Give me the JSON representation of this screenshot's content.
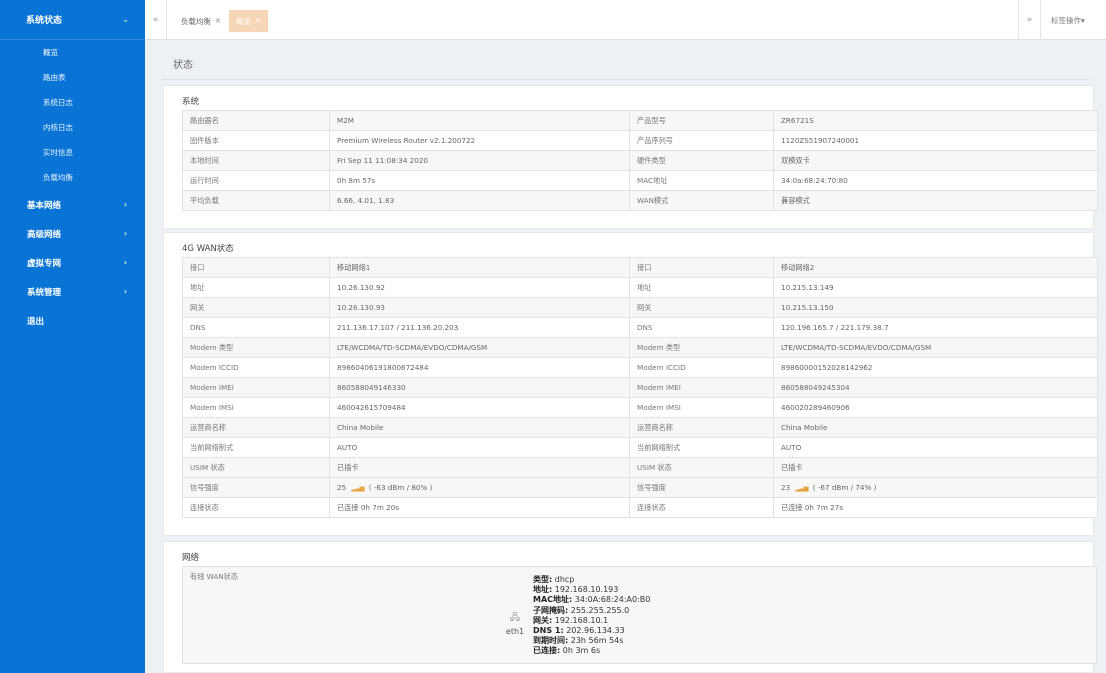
{
  "sidebar": {
    "top": {
      "label": "系统状态"
    },
    "sub_items": [
      {
        "label": "概览"
      },
      {
        "label": "路由表"
      },
      {
        "label": "系统日志"
      },
      {
        "label": "内核日志"
      },
      {
        "label": "实时信息"
      },
      {
        "label": "负载均衡"
      }
    ],
    "menus": [
      {
        "label": "基本网络"
      },
      {
        "label": "高级网络"
      },
      {
        "label": "虚拟专网"
      },
      {
        "label": "系统管理"
      }
    ],
    "logout": "退出"
  },
  "tabbar": {
    "tabs": [
      {
        "label": "负载均衡"
      },
      {
        "label": "概览"
      }
    ],
    "ops_label": "标签操作"
  },
  "page": {
    "title": "状态"
  },
  "system": {
    "title": "系统",
    "rows": [
      {
        "k1": "路由器名",
        "v1": "M2M",
        "k2": "产品型号",
        "v2": "ZR6721S"
      },
      {
        "k1": "固件版本",
        "v1": "Premium Wireless Router v2.1.200722",
        "k2": "产品序列号",
        "v2": "1120ZS51907240001"
      },
      {
        "k1": "本地时间",
        "v1": "Fri Sep 11 11:08:34 2020",
        "k2": "硬件类型",
        "v2": "双模双卡"
      },
      {
        "k1": "运行时间",
        "v1": "0h 8m 57s",
        "k2": "MAC地址",
        "v2": "34:0a:68:24:70:80"
      },
      {
        "k1": "平均负载",
        "v1": "6.66, 4.01, 1.83",
        "k2": "WAN模式",
        "v2": "兼容模式"
      }
    ]
  },
  "wan4g": {
    "title": "4G WAN状态",
    "rows": [
      {
        "k1": "接口",
        "v1": "移动网络1",
        "k2": "接口",
        "v2": "移动网络2"
      },
      {
        "k1": "地址",
        "v1": "10.26.130.92",
        "k2": "地址",
        "v2": "10.215.13.149"
      },
      {
        "k1": "网关",
        "v1": "10.26.130.93",
        "k2": "网关",
        "v2": "10.215.13.150"
      },
      {
        "k1": "DNS",
        "v1": "211.136.17.107 / 211.136.20.203",
        "k2": "DNS",
        "v2": "120.196.165.7 / 221.179.38.7"
      },
      {
        "k1": "Modem 类型",
        "v1": "LTE/WCDMA/TD-SCDMA/EVDO/CDMA/GSM",
        "k2": "Modem 类型",
        "v2": "LTE/WCDMA/TD-SCDMA/EVDO/CDMA/GSM"
      },
      {
        "k1": "Modem ICCID",
        "v1": "89860406191800672484",
        "k2": "Modem ICCID",
        "v2": "89860000152028142962"
      },
      {
        "k1": "Modem IMEI",
        "v1": "860588049146330",
        "k2": "Modem IMEI",
        "v2": "860588049245304"
      },
      {
        "k1": "Modem IMSI",
        "v1": "460042615709484",
        "k2": "Modem IMSI",
        "v2": "460020289460906"
      },
      {
        "k1": "运营商名称",
        "v1": "China Mobile",
        "k2": "运营商名称",
        "v2": "China Mobile"
      },
      {
        "k1": "当前网络制式",
        "v1": "AUTO",
        "k2": "当前网络制式",
        "v2": "AUTO"
      },
      {
        "k1": "USIM 状态",
        "v1": "已插卡",
        "k2": "USIM 状态",
        "v2": "已插卡"
      }
    ],
    "signal": {
      "k1": "信号强度",
      "n1": "25",
      "d1": "( -63 dBm / 80% )",
      "k2": "信号强度",
      "n2": "23",
      "d2": "( -67 dBm / 74% )"
    },
    "conn": {
      "k1": "连接状态",
      "v1": "已连接 0h 7m 20s",
      "k2": "连接状态",
      "v2": "已连接 0h 7m 27s"
    }
  },
  "network": {
    "title": "网络",
    "label": "有线 WAN状态",
    "iface": "eth1",
    "info": [
      {
        "k": "类型:",
        "v": " dhcp"
      },
      {
        "k": "地址:",
        "v": " 192.168.10.193"
      },
      {
        "k": "MAC地址:",
        "v": " 34:0A:68:24:A0:B0"
      },
      {
        "k": "子网掩码:",
        "v": " 255.255.255.0"
      },
      {
        "k": "网关:",
        "v": " 192.168.10.1"
      },
      {
        "k": "DNS 1:",
        "v": " 202.96.134.33"
      },
      {
        "k": "到期时间:",
        "v": " 23h 56m 54s"
      },
      {
        "k": "已连接:",
        "v": " 0h 3m 6s"
      }
    ]
  }
}
